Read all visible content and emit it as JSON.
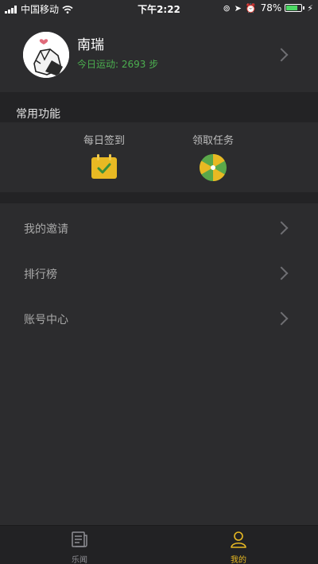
{
  "status_bar": {
    "carrier": "中国移动",
    "time": "下午2:22",
    "battery": "78%",
    "battery_level": 0.78
  },
  "profile": {
    "name": "南瑞",
    "steps_text": "今日运动: 2693 步"
  },
  "section": {
    "title": "常用功能"
  },
  "functions": [
    {
      "label": "每日签到",
      "icon": "calendar-check-icon"
    },
    {
      "label": "领取任务",
      "icon": "pinwheel-icon"
    }
  ],
  "menu": [
    {
      "label": "我的邀请"
    },
    {
      "label": "排行榜"
    },
    {
      "label": "账号中心"
    }
  ],
  "tabs": [
    {
      "label": "乐闻",
      "icon": "news-icon",
      "active": false
    },
    {
      "label": "我的",
      "icon": "person-icon",
      "active": true
    }
  ],
  "colors": {
    "background": "#2c2c2e",
    "band": "#232325",
    "accent_yellow": "#e8b923",
    "steps_green": "#4caf50"
  }
}
